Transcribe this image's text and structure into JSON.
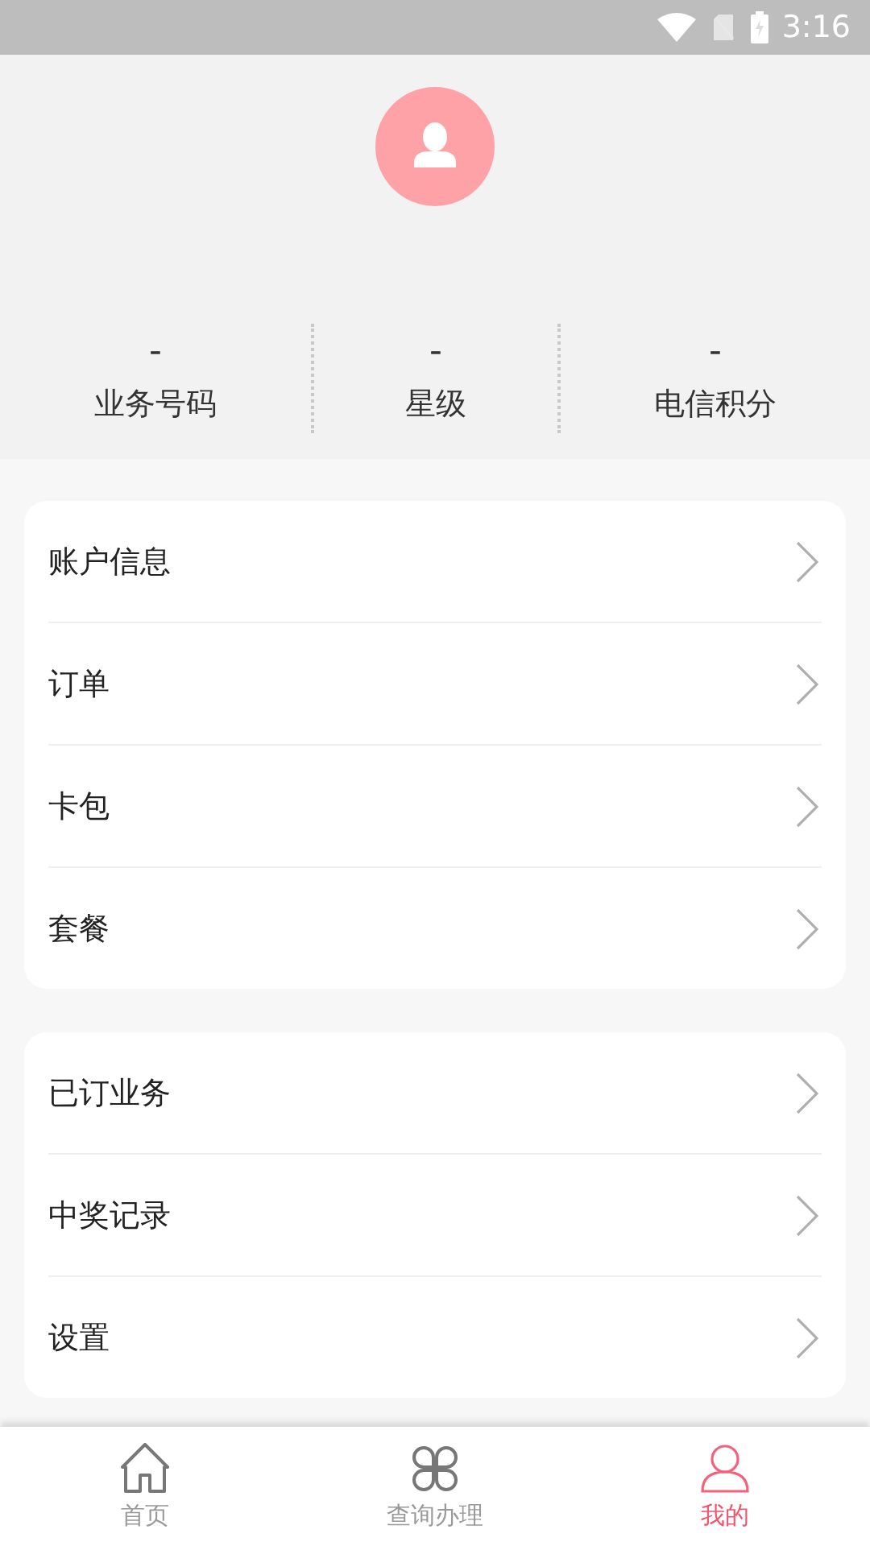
{
  "status_bar": {
    "time": "3:16"
  },
  "stats": [
    {
      "value": "-",
      "label": "业务号码"
    },
    {
      "value": "-",
      "label": "星级"
    },
    {
      "value": "-",
      "label": "电信积分"
    }
  ],
  "menu_groups": [
    {
      "items": [
        {
          "label": "账户信息"
        },
        {
          "label": "订单"
        },
        {
          "label": "卡包"
        },
        {
          "label": "套餐"
        }
      ]
    },
    {
      "items": [
        {
          "label": "已订业务"
        },
        {
          "label": "中奖记录"
        },
        {
          "label": "设置"
        }
      ]
    }
  ],
  "tabs": [
    {
      "label": "首页",
      "kind": "home",
      "selected": false
    },
    {
      "label": "查询办理",
      "kind": "grid",
      "selected": false
    },
    {
      "label": "我的",
      "kind": "person",
      "selected": true
    }
  ]
}
